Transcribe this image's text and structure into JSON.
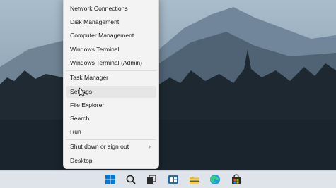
{
  "menu": {
    "items": [
      {
        "label": "Network Connections"
      },
      {
        "label": "Disk Management"
      },
      {
        "label": "Computer Management"
      },
      {
        "label": "Windows Terminal"
      },
      {
        "label": "Windows Terminal (Admin)"
      },
      {
        "label": "Task Manager"
      },
      {
        "label": "Settings"
      },
      {
        "label": "File Explorer"
      },
      {
        "label": "Search"
      },
      {
        "label": "Run"
      },
      {
        "label": "Shut down or sign out"
      },
      {
        "label": "Desktop"
      }
    ],
    "hovered": "Settings"
  },
  "taskbar": {
    "icons": [
      "start-icon",
      "search-icon",
      "task-view-icon",
      "widgets-icon",
      "file-explorer-icon",
      "edge-icon",
      "store-icon"
    ]
  },
  "colors": {
    "menu_bg": "#f3f3f3",
    "taskbar_bg": "#dfe3ea",
    "start_blue": "#0078d4"
  }
}
